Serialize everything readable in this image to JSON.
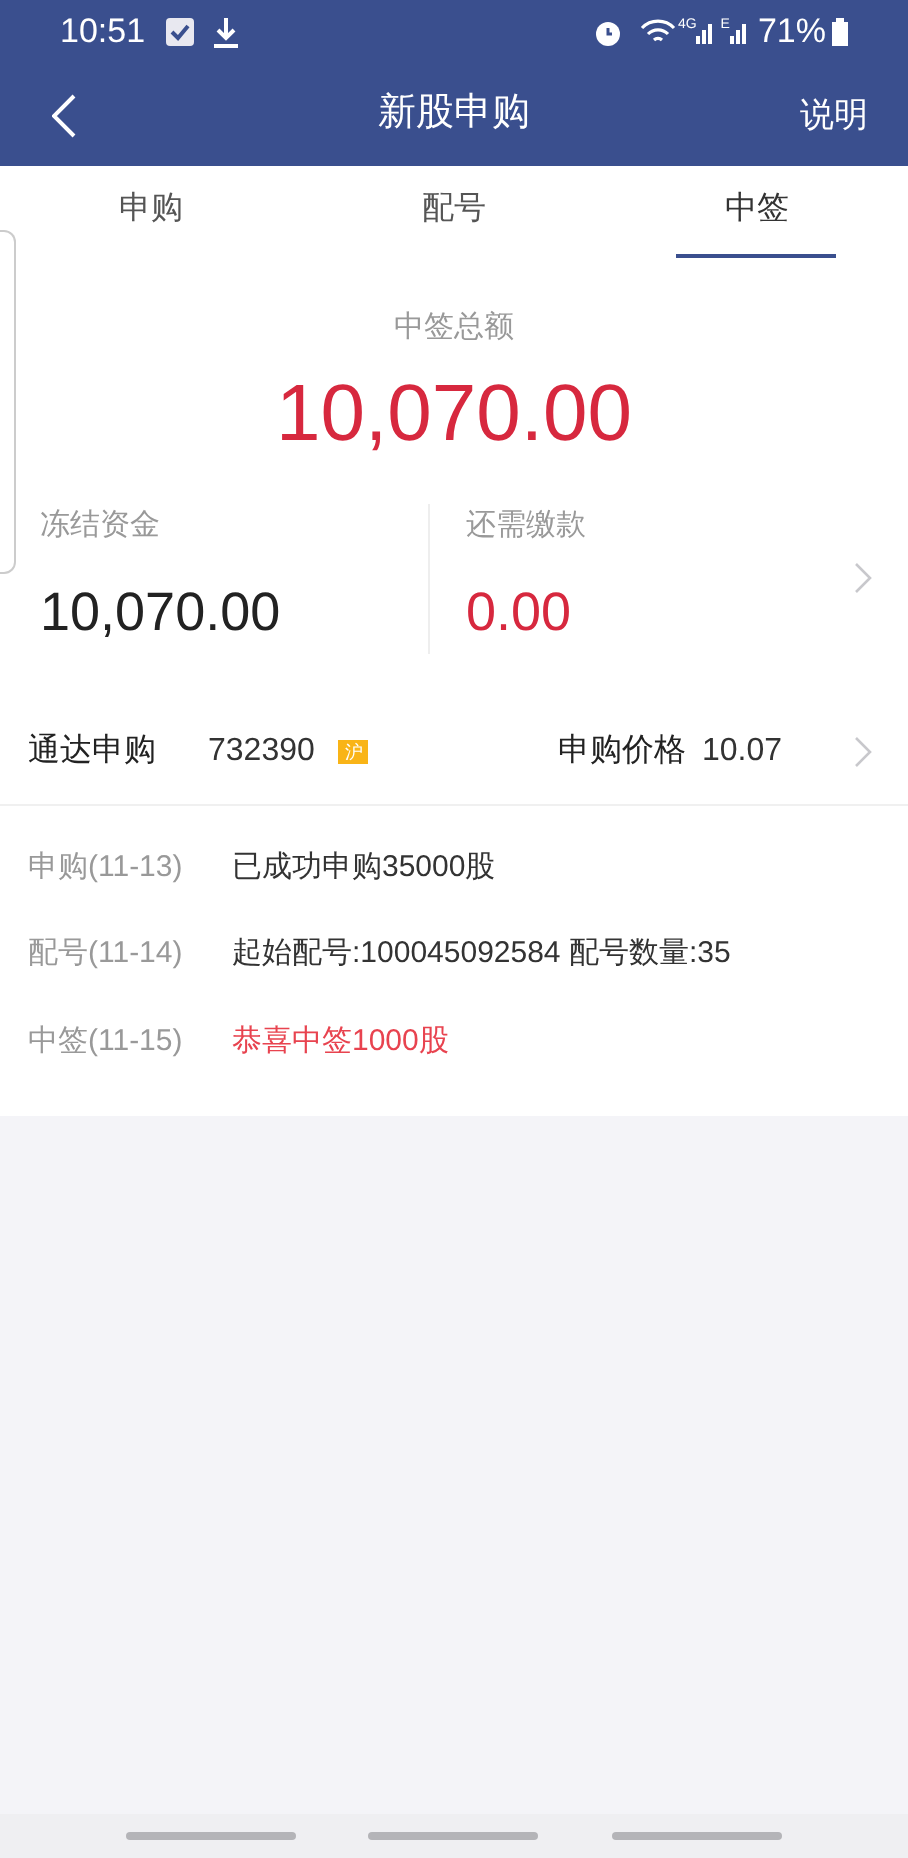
{
  "status_bar": {
    "time": "10:51",
    "network_1": "4G",
    "network_2": "E",
    "battery": "71%"
  },
  "header": {
    "title": "新股申购",
    "action": "说明"
  },
  "tabs": [
    {
      "label": "申购",
      "selected": false
    },
    {
      "label": "配号",
      "selected": false
    },
    {
      "label": "中签",
      "selected": true
    }
  ],
  "summary": {
    "label": "中签总额",
    "amount": "10,070.00"
  },
  "stats": [
    {
      "label": "冻结资金",
      "value": "10,070.00",
      "kind": "neutral"
    },
    {
      "label": "还需缴款",
      "value": "0.00",
      "kind": "alert"
    }
  ],
  "stock": {
    "name": "通达申购",
    "code": "732390",
    "market": "沪",
    "price_label": "申购价格",
    "price": "10.07"
  },
  "timeline": [
    {
      "step": "申购(11-13)",
      "text": "已成功申购35000股",
      "highlighted": false
    },
    {
      "step": "配号(11-14)",
      "text": "起始配号:100045092584 配号数量:35",
      "highlighted": false
    },
    {
      "step": "中签(11-15)",
      "text": "恭喜中签1000股",
      "highlighted": true
    }
  ]
}
